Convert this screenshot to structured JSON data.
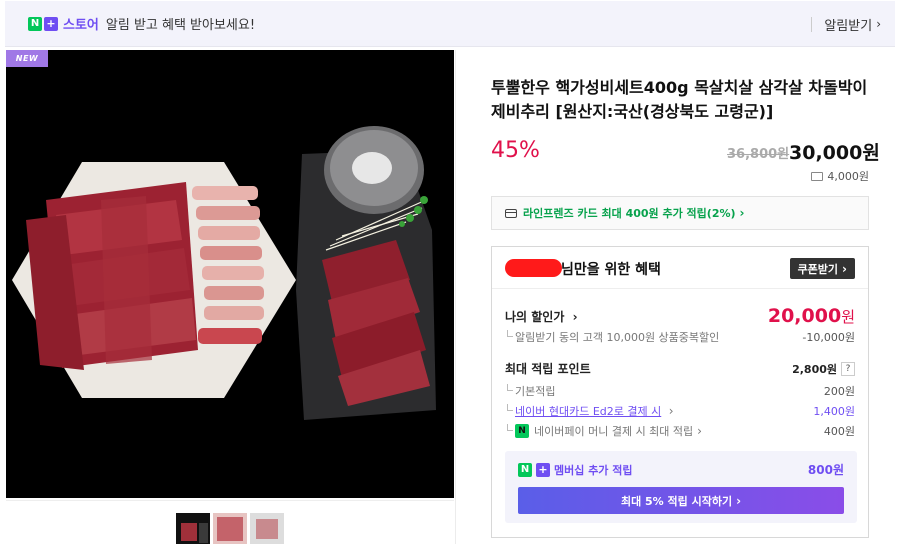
{
  "banner": {
    "logo_n": "N",
    "logo_plus": "+",
    "logo_store": "스토어",
    "message": "알림 받고 혜택 받아보세요!",
    "alert_button": "알림받기"
  },
  "product": {
    "badge": "NEW",
    "title": "투뿔한우 핵가성비세트400g 목살치살 삼각살 차돌박이 제비추리 [원산지:국산(경상북도 고령군)]",
    "discount": "45%",
    "original_price": "36,800원",
    "sale_price": "30,000원",
    "shipping": "4,000원"
  },
  "card_promo": {
    "text": "라인프렌즈 카드 최대 400원 추가 적립(2%)"
  },
  "benefit": {
    "title": "님만을 위한 혜택",
    "coupon_button": "쿠폰받기",
    "my_discount_label": "나의 할인가",
    "my_discount_price": "20,000",
    "my_discount_won": "원",
    "alert_discount_desc": "알림받기 동의 고객 10,000원 상품중복할인",
    "alert_discount_value": "-10,000원",
    "max_point_label": "최대 적립 포인트",
    "max_point_value": "2,800원",
    "help": "?",
    "basic_label": "기본적립",
    "basic_value": "200원",
    "hyundai_label": "네이버 현대카드 Ed2로 결제 시",
    "hyundai_value": "1,400원",
    "npay_icon": "N",
    "npay_label": "네이버페이 머니 결제 시 최대 적립",
    "npay_value": "400원",
    "membership_label": "멤버십 추가 적립",
    "membership_value": "800원",
    "membership_button": "최대 5% 적립 시작하기"
  },
  "icons": {
    "chevron": "›",
    "truck": "truck-icon",
    "card": "card-icon"
  },
  "colors": {
    "naver_green": "#03c75a",
    "naver_purple": "#6f4ef2",
    "price_red": "#e0114b"
  }
}
